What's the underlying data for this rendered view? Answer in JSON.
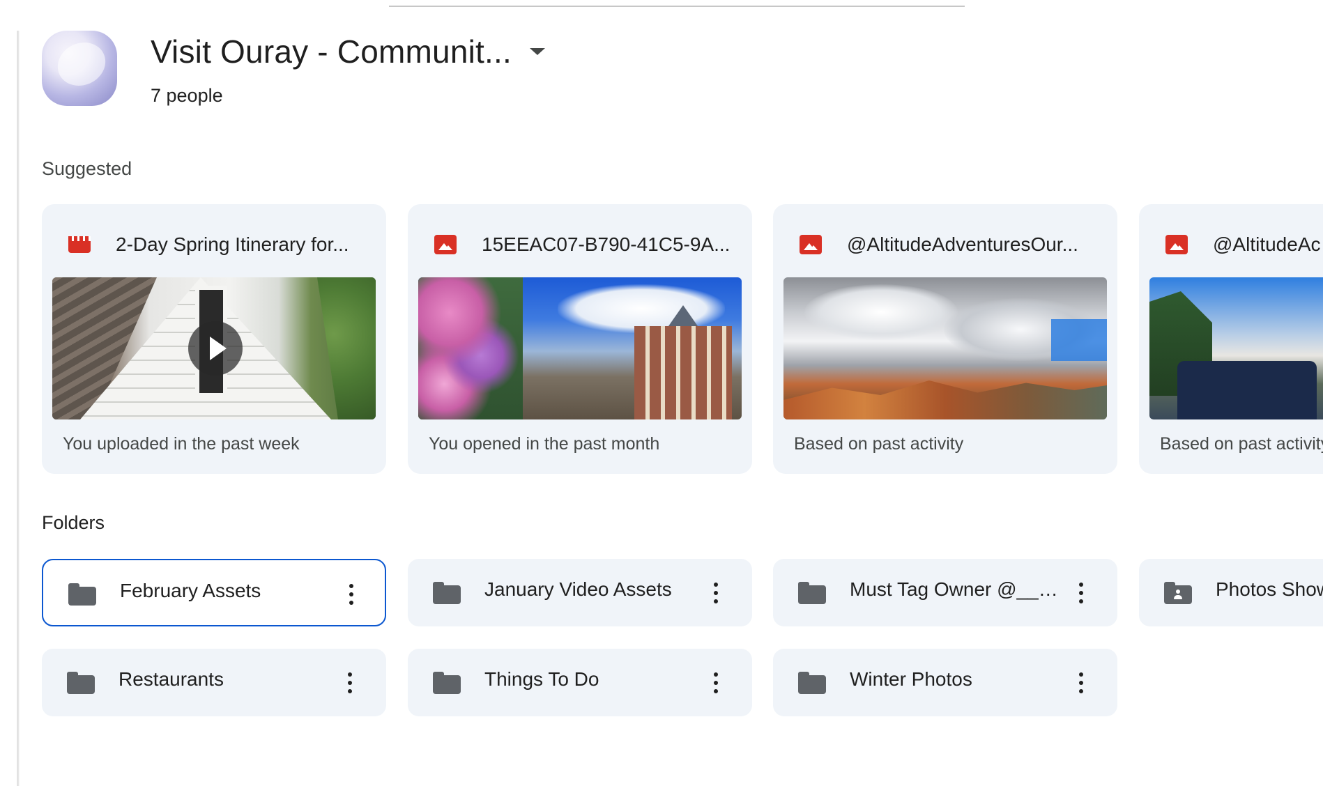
{
  "header": {
    "title": "Visit Ouray - Communit...",
    "people_count": "7 people"
  },
  "sections": {
    "suggested": "Suggested",
    "folders": "Folders"
  },
  "suggested": [
    {
      "title": "2-Day Spring Itinerary for...",
      "reason": "You uploaded in the past week",
      "file_type": "video",
      "icon": "video-file-icon"
    },
    {
      "title": "15EEAC07-B790-41C5-9A...",
      "reason": "You opened in the past month",
      "file_type": "image",
      "icon": "image-file-icon"
    },
    {
      "title": "@AltitudeAdventuresOur...",
      "reason": "Based on past activity",
      "file_type": "image",
      "icon": "image-file-icon"
    },
    {
      "title": "@AltitudeAc",
      "reason": "Based on past activity",
      "file_type": "image",
      "icon": "image-file-icon"
    }
  ],
  "folders": [
    {
      "name": "February Assets",
      "selected": true,
      "icon": "folder-icon"
    },
    {
      "name": "January Video Assets",
      "selected": false,
      "icon": "folder-icon"
    },
    {
      "name": "Must Tag Owner @___...",
      "selected": false,
      "icon": "folder-icon"
    },
    {
      "name": "Photos Show",
      "selected": false,
      "icon": "shared-folder-icon"
    },
    {
      "name": "Restaurants",
      "selected": false,
      "icon": "folder-icon"
    },
    {
      "name": "Things To Do",
      "selected": false,
      "icon": "folder-icon"
    },
    {
      "name": "Winter Photos",
      "selected": false,
      "icon": "folder-icon"
    }
  ],
  "colors": {
    "card_bg": "#f0f4f9",
    "selected_border": "#0b57d0",
    "file_icon_red": "#d93025",
    "folder_gray": "#5f6368"
  }
}
